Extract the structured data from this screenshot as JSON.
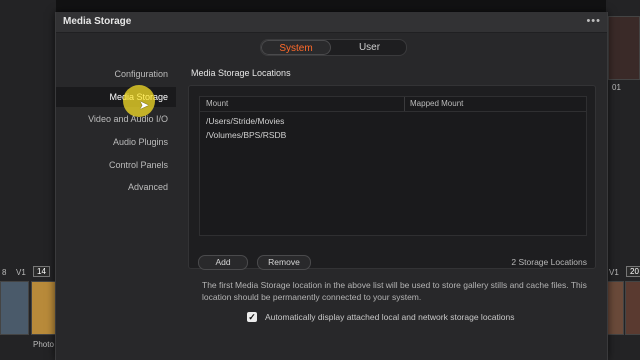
{
  "background": {
    "left_badges": [
      "8",
      "V1",
      "14"
    ],
    "left_caption": "Photo",
    "right_badges": [
      "01",
      "V1",
      "20"
    ]
  },
  "dialog": {
    "title": "Media Storage",
    "more_icon": "more-horizontal-icon",
    "tabs": [
      {
        "label": "System",
        "active": true
      },
      {
        "label": "User",
        "active": false
      }
    ],
    "sidebar": {
      "items": [
        {
          "label": "Configuration",
          "active": false
        },
        {
          "label": "Media Storage",
          "active": true
        },
        {
          "label": "Video and Audio I/O",
          "active": false
        },
        {
          "label": "Audio Plugins",
          "active": false
        },
        {
          "label": "Control Panels",
          "active": false
        },
        {
          "label": "Advanced",
          "active": false
        }
      ]
    },
    "main": {
      "section_title": "Media Storage Locations",
      "table": {
        "columns": [
          "Mount",
          "Mapped Mount"
        ],
        "rows": [
          {
            "mount": "/Users/Stride/Movies",
            "mapped": ""
          },
          {
            "mount": "/Volumes/BPS/RSDB",
            "mapped": ""
          }
        ]
      },
      "add_label": "Add",
      "remove_label": "Remove",
      "count_label": "2 Storage Locations",
      "info_text": "The first Media Storage location in the above list will be used to store gallery stills and cache files. This location should be permanently connected to your system.",
      "auto_display": {
        "checked": true,
        "label": "Automatically display attached local and network storage locations"
      }
    }
  },
  "colors": {
    "accent": "#ff6a2a",
    "cursor_highlight": "#ffe628"
  }
}
